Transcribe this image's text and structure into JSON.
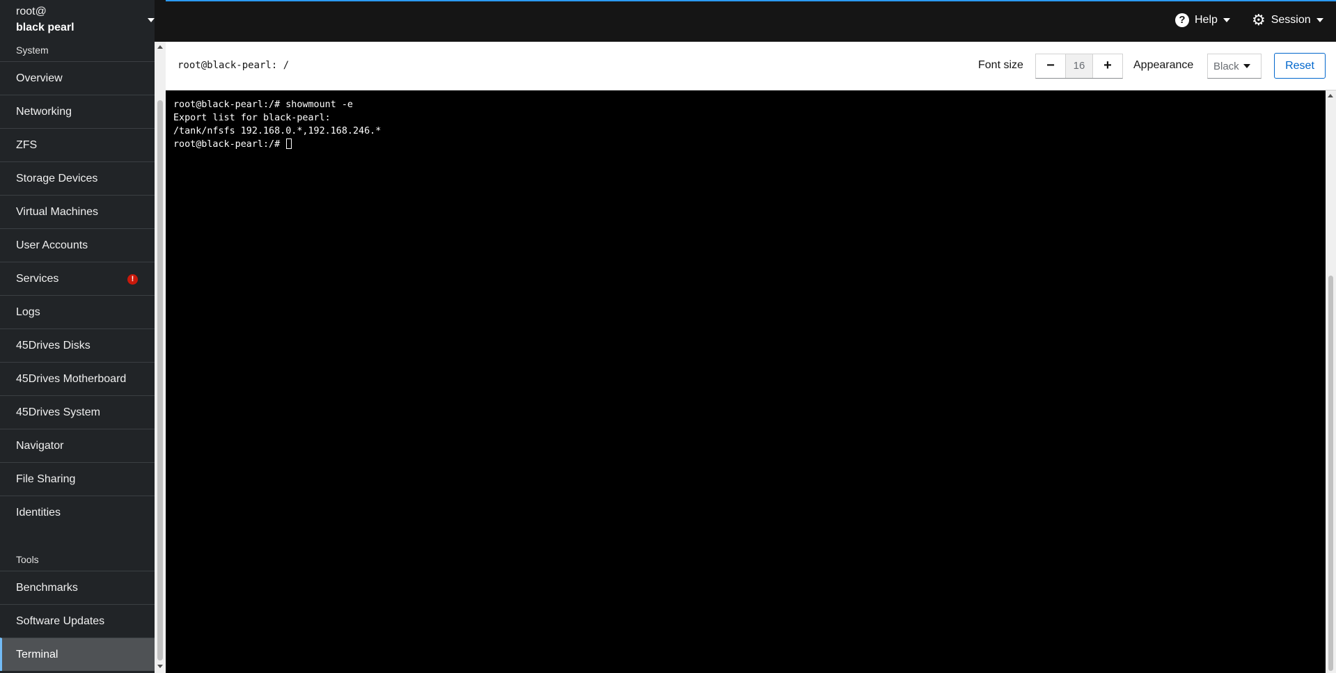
{
  "host": {
    "user": "root@",
    "name": "black pearl"
  },
  "sidebar": {
    "sections": [
      {
        "title": "System"
      },
      {
        "title": "Tools"
      }
    ],
    "items": [
      {
        "label": "Overview"
      },
      {
        "label": "Networking"
      },
      {
        "label": "ZFS"
      },
      {
        "label": "Storage Devices"
      },
      {
        "label": "Virtual Machines"
      },
      {
        "label": "User Accounts"
      },
      {
        "label": "Services",
        "alert": "!"
      },
      {
        "label": "Logs"
      },
      {
        "label": "45Drives Disks"
      },
      {
        "label": "45Drives Motherboard"
      },
      {
        "label": "45Drives System"
      },
      {
        "label": "Navigator"
      },
      {
        "label": "File Sharing"
      },
      {
        "label": "Identities"
      }
    ],
    "tools": [
      {
        "label": "Benchmarks"
      },
      {
        "label": "Software Updates"
      },
      {
        "label": "Terminal",
        "active": true
      }
    ]
  },
  "header": {
    "help_label": "Help",
    "session_label": "Session",
    "help_icon": "question-circle-icon",
    "session_icon": "gear-icon"
  },
  "toolbar": {
    "title": "root@black-pearl: /",
    "font_size_label": "Font size",
    "font_size_minus": "−",
    "font_size_value": "16",
    "font_size_plus": "+",
    "appearance_label": "Appearance",
    "appearance_value": "Black",
    "reset_label": "Reset"
  },
  "terminal": {
    "lines": [
      "root@black-pearl:/# showmount -e",
      "Export list for black-pearl:",
      "/tank/nfsfs 192.168.0.*,192.168.246.*",
      "root@black-pearl:/# "
    ]
  },
  "colors": {
    "accent": "#2b9af3",
    "sidebar_bg": "#212427",
    "active_item_bg": "#4f5255",
    "active_marker": "#73bcf7",
    "alert": "#c9190b",
    "link": "#0066cc",
    "terminal_bg": "#000000"
  }
}
